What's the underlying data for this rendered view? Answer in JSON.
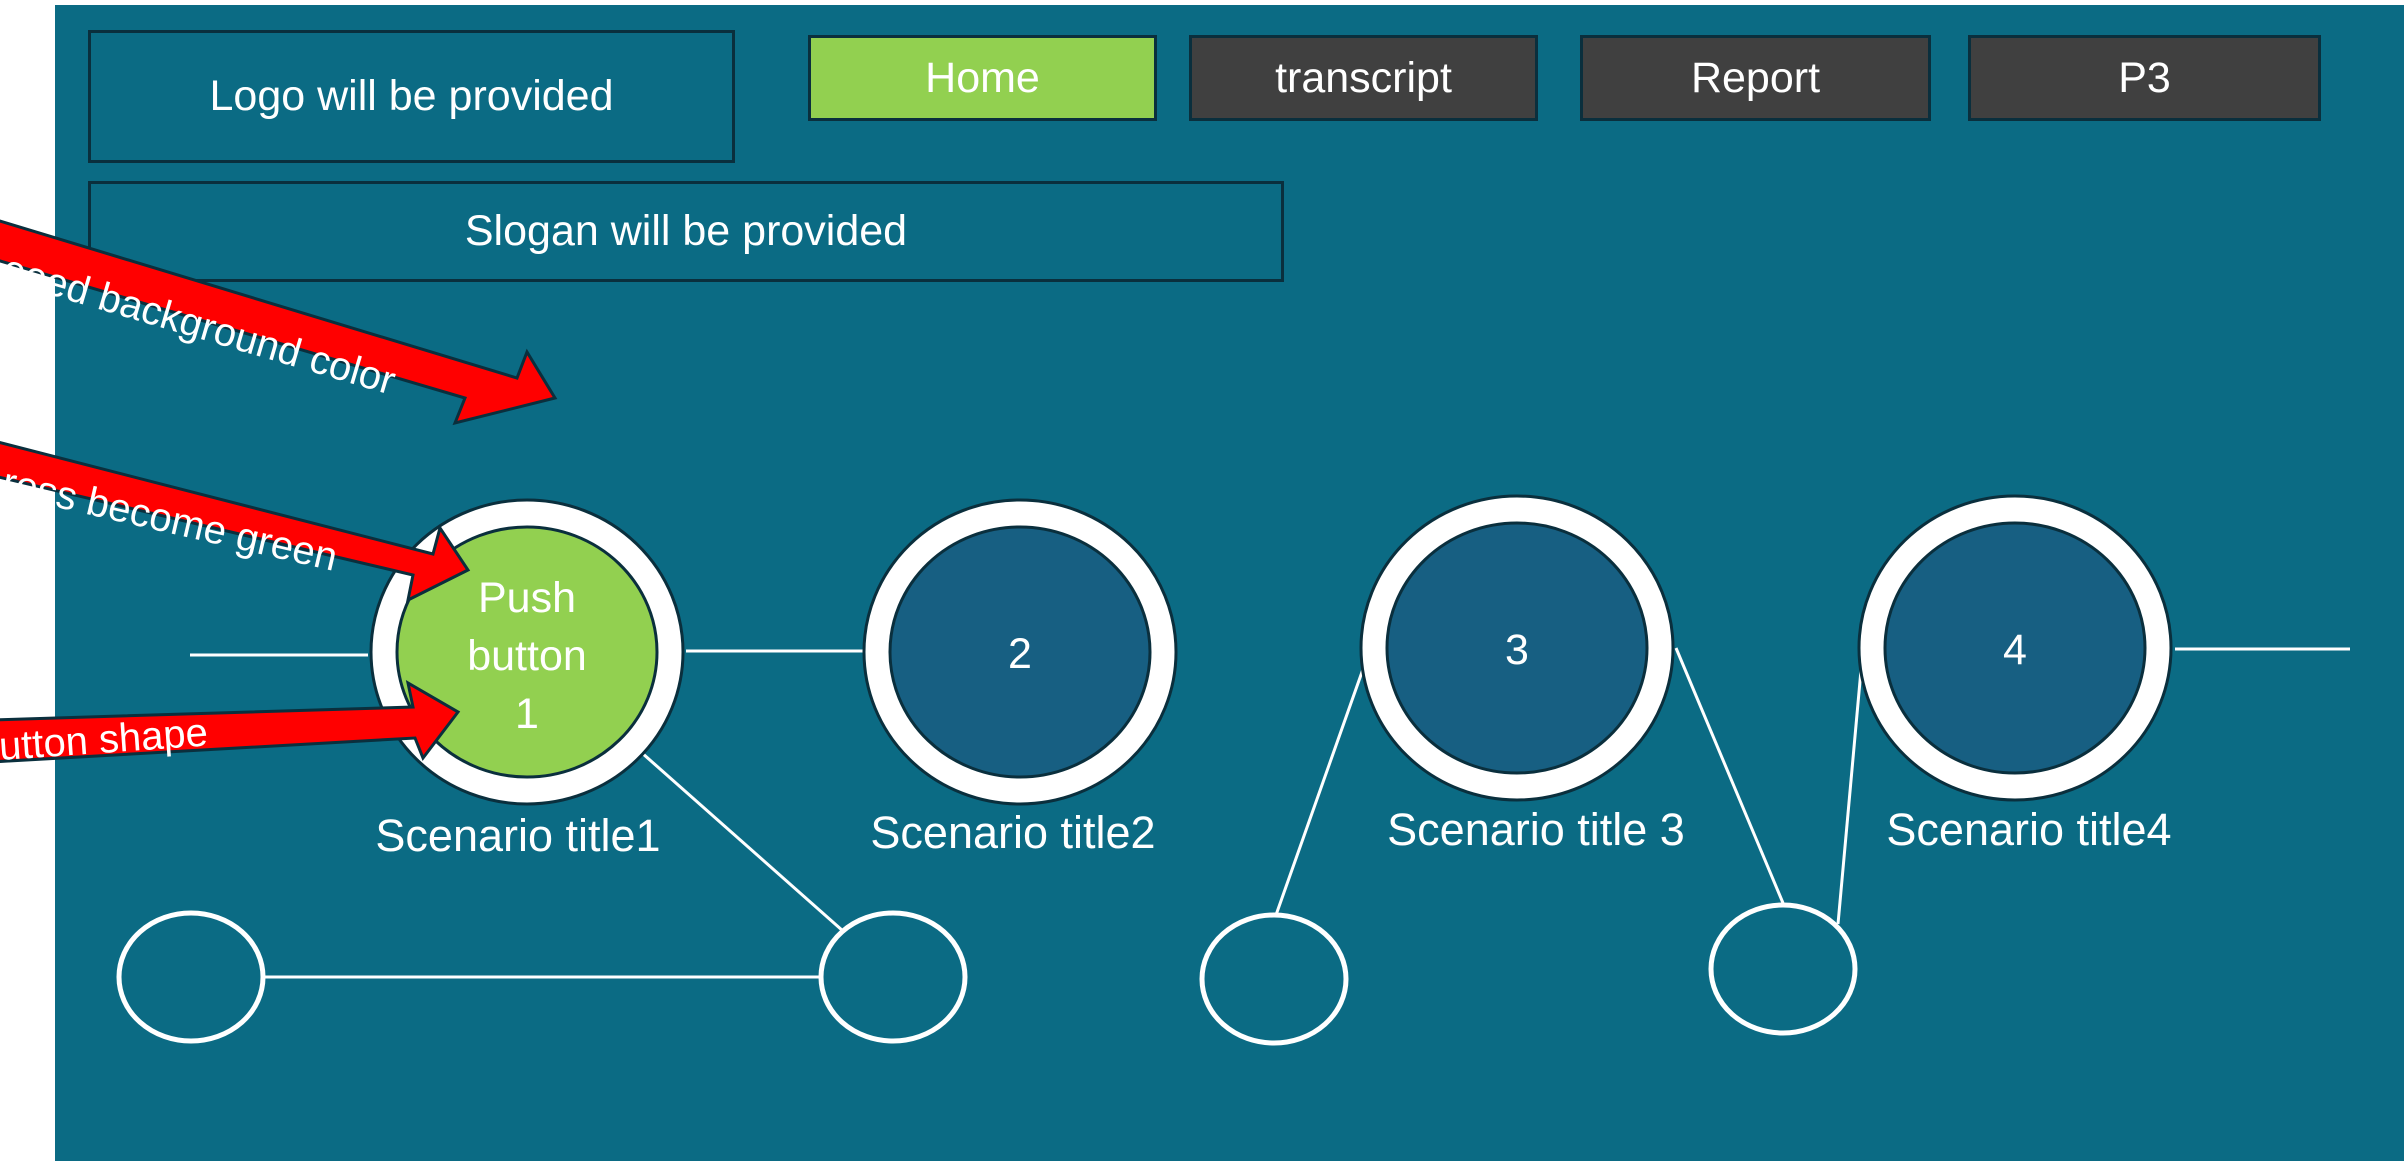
{
  "header": {
    "logo_text": "Logo will be provided",
    "slogan_text": "Slogan will be provided"
  },
  "nav": [
    {
      "label": "Home",
      "active": true
    },
    {
      "label": "transcript",
      "active": false
    },
    {
      "label": "Report",
      "active": false
    },
    {
      "label": "P3",
      "active": false
    }
  ],
  "scenarios": [
    {
      "button_lines": [
        "Push",
        "button",
        "1"
      ],
      "title": "Scenario title1",
      "state": "pressed"
    },
    {
      "button_lines": [
        "2"
      ],
      "title": "Scenario title2",
      "state": "default"
    },
    {
      "button_lines": [
        "3"
      ],
      "title": "Scenario title 3",
      "state": "default"
    },
    {
      "button_lines": [
        "4"
      ],
      "title": "Scenario title4",
      "state": "default"
    }
  ],
  "annotations": [
    {
      "text": "eeed background color"
    },
    {
      "text": "ress become green"
    },
    {
      "text": "utton shape"
    }
  ],
  "colors": {
    "background": "#0b6b84",
    "pressed_green": "#92d050",
    "button_blue": "#175f82",
    "nav_dark": "#404040",
    "annotation_red": "#ff0000"
  }
}
